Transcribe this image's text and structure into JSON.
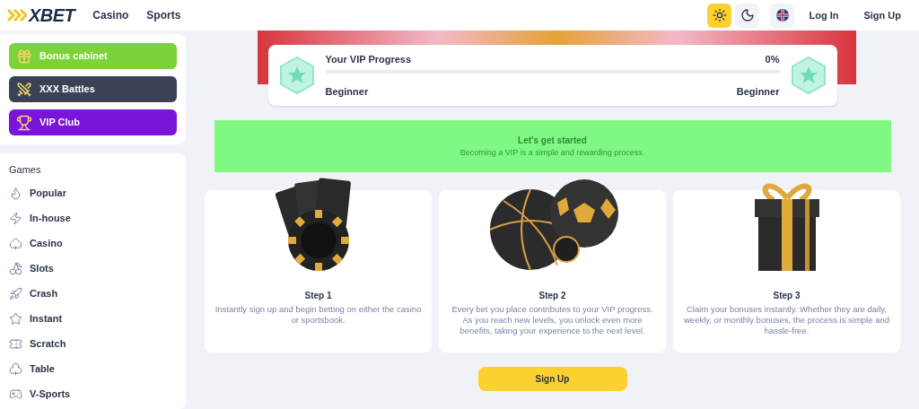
{
  "header": {
    "logo": "XBET",
    "nav": [
      "Casino",
      "Sports"
    ],
    "theme_buttons": [
      {
        "kind": "light",
        "selected": true
      },
      {
        "kind": "dark",
        "selected": false
      }
    ],
    "actions": [
      "Log In",
      "Sign Up"
    ]
  },
  "promos": [
    {
      "label": "Bonus cabinet",
      "kind": "gift",
      "color": "#7bd23a"
    },
    {
      "label": "XXX Battles",
      "kind": "swords",
      "color": "#3a4356"
    },
    {
      "label": "VIP Club",
      "kind": "trophy",
      "color": "#7a14d9"
    }
  ],
  "games": {
    "title": "Games",
    "items": [
      {
        "label": "Popular",
        "kind": "flame"
      },
      {
        "label": "In-house",
        "kind": "zap"
      },
      {
        "label": "Casino",
        "kind": "spade"
      },
      {
        "label": "Slots",
        "kind": "cherry"
      },
      {
        "label": "Crash",
        "kind": "rocket"
      },
      {
        "label": "Instant",
        "kind": "star"
      },
      {
        "label": "Scratch",
        "kind": "ticket"
      },
      {
        "label": "Table",
        "kind": "cards"
      },
      {
        "label": "V-Sports",
        "kind": "gamepad"
      }
    ]
  },
  "progress": {
    "title": "Your VIP Progress",
    "percent": "0%",
    "level": 0,
    "from": "Beginner",
    "to": "Beginner"
  },
  "banner": {
    "title": "Let's get started",
    "subtitle": "Becoming a VIP is a simple and rewarding process."
  },
  "steps": [
    {
      "kind": "cards",
      "title": "Step 1",
      "text": "Instantly sign up and begin betting on either the casino or sportsbook."
    },
    {
      "kind": "balls",
      "title": "Step 2",
      "text": "Every bet you place contributes to your VIP progress. As you reach new levels, you unlock even more benefits, taking your experience to the next level."
    },
    {
      "kind": "gift",
      "title": "Step 3",
      "text": "Claim your bonuses instantly. Whether they are daily, weekly, or monthly bonuses, the process is simple and hassle-free."
    }
  ],
  "cta": "Sign Up"
}
